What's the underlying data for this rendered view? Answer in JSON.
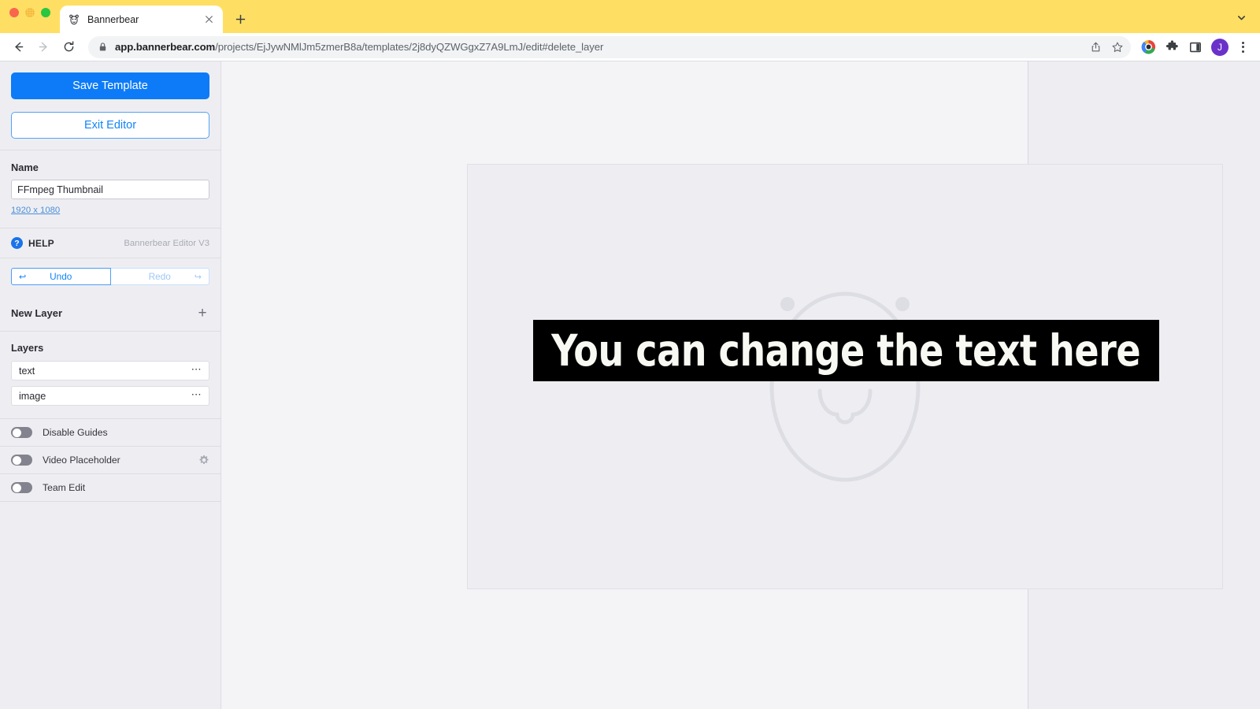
{
  "browser": {
    "tab": {
      "title": "Bannerbear",
      "favicon_icon": "bear-head-icon",
      "close_icon": "close-icon"
    },
    "new_tab_icon": "plus-icon",
    "tabstrip_chevron_icon": "chevron-down-icon",
    "traffic_lights": [
      "close-red",
      "minimize-yellow",
      "zoom-green"
    ],
    "nav": {
      "back_icon": "arrow-left-icon",
      "forward_icon": "arrow-right-icon",
      "reload_icon": "reload-icon"
    },
    "omnibox": {
      "lock_icon": "lock-icon",
      "url_host": "app.bannerbear.com",
      "url_path": "/projects/EjJywNMlJm5zmerB8a/templates/2j8dyQZWGgxZ7A9LmJ/edit#delete_layer",
      "share_icon": "share-icon",
      "bookmark_icon": "star-icon"
    },
    "toolbar_icons": [
      "extension-colorful-icon",
      "puzzle-extensions-icon",
      "side-panel-icon"
    ],
    "profile_initial": "J",
    "menu_icon": "three-dots-vertical-icon"
  },
  "sidebar": {
    "save_template_label": "Save Template",
    "exit_editor_label": "Exit Editor",
    "name_label": "Name",
    "name_value": "FFmpeg Thumbnail",
    "dimensions_label": "1920 x 1080",
    "help_label": "HELP",
    "help_icon": "question-circle-icon",
    "version_label": "Bannerbear Editor V3",
    "undo_label": "Undo",
    "undo_icon": "undo-arrow-icon",
    "redo_label": "Redo",
    "redo_icon": "redo-arrow-icon",
    "new_layer_label": "New Layer",
    "add_layer_icon": "plus-icon",
    "layers_title": "Layers",
    "layers": [
      {
        "name": "text",
        "menu_icon": "ellipsis-icon"
      },
      {
        "name": "image",
        "menu_icon": "ellipsis-icon"
      }
    ],
    "toggles": [
      {
        "label": "Disable Guides",
        "on": false,
        "has_settings": false
      },
      {
        "label": "Video Placeholder",
        "on": false,
        "has_settings": true,
        "settings_icon": "gear-icon"
      },
      {
        "label": "Team Edit",
        "on": false,
        "has_settings": false
      }
    ]
  },
  "canvas": {
    "placeholder_icon": "bear-face-placeholder",
    "text_layer_value": "You can change the text here",
    "text_color": "#f7f9f2",
    "text_background": "#000000",
    "canvas_background": "#eeeef2",
    "workspace_background": "#f4f4f6"
  },
  "colors": {
    "accent_blue": "#0d7bf7",
    "tab_strip_yellow": "#ffdf63",
    "profile_purple": "#6a32c9"
  }
}
